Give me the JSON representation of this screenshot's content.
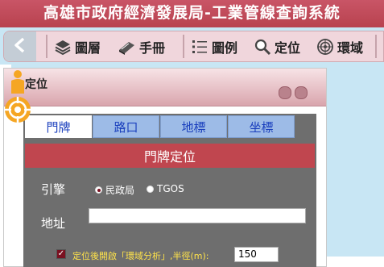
{
  "app": {
    "title": "高雄市政府經濟發展局-工業管線查詢系統"
  },
  "toolbar": {
    "items": [
      {
        "label": "圖層",
        "icon": "layers-icon"
      },
      {
        "label": "手冊",
        "icon": "book-icon"
      },
      {
        "label": "圖例",
        "icon": "list-icon"
      },
      {
        "label": "定位",
        "icon": "magnifier-icon"
      },
      {
        "label": "環域",
        "icon": "radar-icon"
      }
    ]
  },
  "panel": {
    "title": "定位",
    "tabs": [
      {
        "label": "門牌",
        "active": true
      },
      {
        "label": "路口",
        "active": false
      },
      {
        "label": "地標",
        "active": false
      },
      {
        "label": "坐標",
        "active": false
      }
    ],
    "section_title": "門牌定位",
    "engine_label": "引擎",
    "engine_options": [
      {
        "label": "民政局",
        "selected": true
      },
      {
        "label": "TGOS",
        "selected": false
      }
    ],
    "address_label": "地址",
    "address_value": "",
    "buffer_checkbox_label": "定位後開啟「環域分析」,半徑(m):",
    "buffer_checked": true,
    "radius_value": "150"
  },
  "colors": {
    "title_bar": "#b8424f",
    "toolbar_bg": "#f0d6dc",
    "section_bar": "#c0464f",
    "tab_inactive": "#9dbbe7",
    "locate_badge": "#f5a623"
  }
}
